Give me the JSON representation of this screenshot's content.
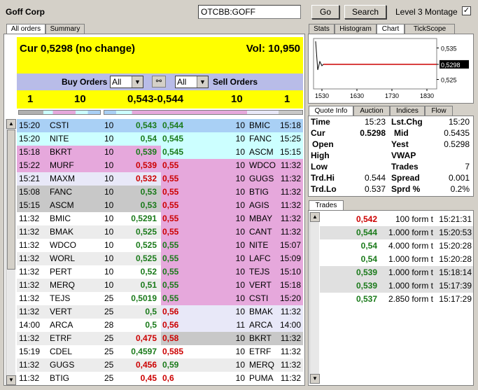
{
  "header": {
    "company": "Goff Corp",
    "symbol_value": "OTCBB:GOFF",
    "go_label": "Go",
    "search_label": "Search",
    "level3_label": "Level 3 Montage",
    "level3_checked": true
  },
  "left_tabs": [
    "All orders",
    "Summary"
  ],
  "summary": {
    "cur": "Cur 0,5298 (no change)",
    "vol": "Vol: 10,950",
    "buy_label": "Buy Orders",
    "buy_filter": "All",
    "sell_label": "Sell Orders",
    "sell_filter": "All",
    "bid_count": "1",
    "bid_size": "10",
    "spread": "0,543-0,544",
    "ask_size": "10",
    "ask_count": "1"
  },
  "bids": [
    {
      "time": "15:20",
      "mm": "CSTI",
      "size": "10",
      "price": "0,543",
      "color": "green",
      "bg": "#a9d0f5"
    },
    {
      "time": "15:20",
      "mm": "NITE",
      "size": "10",
      "price": "0,54",
      "color": "green",
      "bg": "#ccffff"
    },
    {
      "time": "15:18",
      "mm": "BKRT",
      "size": "10",
      "price": "0,539",
      "color": "green",
      "bg": "#e6a8dc"
    },
    {
      "time": "15:22",
      "mm": "MURF",
      "size": "10",
      "price": "0,539",
      "color": "red",
      "bg": "#e6a8dc"
    },
    {
      "time": "15:21",
      "mm": "MAXM",
      "size": "10",
      "price": "0,532",
      "color": "red",
      "bg": "#e8e8f8"
    },
    {
      "time": "15:08",
      "mm": "FANC",
      "size": "10",
      "price": "0,53",
      "color": "green",
      "bg": "#c8c8c8"
    },
    {
      "time": "15:15",
      "mm": "ASCM",
      "size": "10",
      "price": "0,53",
      "color": "green",
      "bg": "#c8c8c8"
    },
    {
      "time": "11:32",
      "mm": "BMIC",
      "size": "10",
      "price": "0,5291",
      "color": "green",
      "bg": "#ffffff"
    },
    {
      "time": "11:32",
      "mm": "BMAK",
      "size": "10",
      "price": "0,525",
      "color": "green",
      "bg": "#ececec"
    },
    {
      "time": "11:32",
      "mm": "WDCO",
      "size": "10",
      "price": "0,525",
      "color": "green",
      "bg": "#ffffff"
    },
    {
      "time": "11:32",
      "mm": "WORL",
      "size": "10",
      "price": "0,525",
      "color": "green",
      "bg": "#ececec"
    },
    {
      "time": "11:32",
      "mm": "PERT",
      "size": "10",
      "price": "0,52",
      "color": "green",
      "bg": "#ffffff"
    },
    {
      "time": "11:32",
      "mm": "MERQ",
      "size": "10",
      "price": "0,51",
      "color": "green",
      "bg": "#ececec"
    },
    {
      "time": "11:32",
      "mm": "TEJS",
      "size": "25",
      "price": "0,5019",
      "color": "green",
      "bg": "#ffffff"
    },
    {
      "time": "11:32",
      "mm": "VERT",
      "size": "25",
      "price": "0,5",
      "color": "green",
      "bg": "#ececec"
    },
    {
      "time": "14:00",
      "mm": "ARCA",
      "size": "28",
      "price": "0,5",
      "color": "green",
      "bg": "#ffffff"
    },
    {
      "time": "11:32",
      "mm": "ETRF",
      "size": "25",
      "price": "0,475",
      "color": "red",
      "bg": "#ececec"
    },
    {
      "time": "15:19",
      "mm": "CDEL",
      "size": "25",
      "price": "0,4597",
      "color": "green",
      "bg": "#ffffff"
    },
    {
      "time": "11:32",
      "mm": "GUGS",
      "size": "25",
      "price": "0,456",
      "color": "red",
      "bg": "#ececec"
    },
    {
      "time": "11:32",
      "mm": "BTIG",
      "size": "25",
      "price": "0,45",
      "color": "red",
      "bg": "#ffffff"
    }
  ],
  "asks": [
    {
      "price": "0,544",
      "color": "green",
      "size": "10",
      "mm": "BMIC",
      "time": "15:18",
      "bg": "#a9d0f5"
    },
    {
      "price": "0,545",
      "color": "green",
      "size": "10",
      "mm": "FANC",
      "time": "15:25",
      "bg": "#ccffff"
    },
    {
      "price": "0,545",
      "color": "green",
      "size": "10",
      "mm": "ASCM",
      "time": "15:15",
      "bg": "#ccffff"
    },
    {
      "price": "0,55",
      "color": "red",
      "size": "10",
      "mm": "WDCO",
      "time": "11:32",
      "bg": "#e6a8dc"
    },
    {
      "price": "0,55",
      "color": "red",
      "size": "10",
      "mm": "GUGS",
      "time": "11:32",
      "bg": "#e6a8dc"
    },
    {
      "price": "0,55",
      "color": "red",
      "size": "10",
      "mm": "BTIG",
      "time": "11:32",
      "bg": "#e6a8dc"
    },
    {
      "price": "0,55",
      "color": "red",
      "size": "10",
      "mm": "AGIS",
      "time": "11:32",
      "bg": "#e6a8dc"
    },
    {
      "price": "0,55",
      "color": "red",
      "size": "10",
      "mm": "MBAY",
      "time": "11:32",
      "bg": "#e6a8dc"
    },
    {
      "price": "0,55",
      "color": "red",
      "size": "10",
      "mm": "CANT",
      "time": "11:32",
      "bg": "#e6a8dc"
    },
    {
      "price": "0,55",
      "color": "green",
      "size": "10",
      "mm": "NITE",
      "time": "15:07",
      "bg": "#e6a8dc"
    },
    {
      "price": "0,55",
      "color": "green",
      "size": "10",
      "mm": "LAFC",
      "time": "15:09",
      "bg": "#e6a8dc"
    },
    {
      "price": "0,55",
      "color": "green",
      "size": "10",
      "mm": "TEJS",
      "time": "15:10",
      "bg": "#e6a8dc"
    },
    {
      "price": "0,55",
      "color": "green",
      "size": "10",
      "mm": "VERT",
      "time": "15:18",
      "bg": "#e6a8dc"
    },
    {
      "price": "0,55",
      "color": "green",
      "size": "10",
      "mm": "CSTI",
      "time": "15:20",
      "bg": "#e6a8dc"
    },
    {
      "price": "0,56",
      "color": "red",
      "size": "10",
      "mm": "BMAK",
      "time": "11:32",
      "bg": "#e8e8f8"
    },
    {
      "price": "0,56",
      "color": "red",
      "size": "11",
      "mm": "ARCA",
      "time": "14:00",
      "bg": "#e8e8f8"
    },
    {
      "price": "0,58",
      "color": "red",
      "size": "10",
      "mm": "BKRT",
      "time": "11:32",
      "bg": "#c8c8c8"
    },
    {
      "price": "0,585",
      "color": "red",
      "size": "10",
      "mm": "ETRF",
      "time": "11:32",
      "bg": "#ffffff"
    },
    {
      "price": "0,59",
      "color": "green",
      "size": "10",
      "mm": "MERQ",
      "time": "11:32",
      "bg": "#ececec"
    },
    {
      "price": "0,6",
      "color": "red",
      "size": "10",
      "mm": "PUMA",
      "time": "11:32",
      "bg": "#ffffff"
    }
  ],
  "chart_tabs": [
    "Stats",
    "Histogram",
    "Chart",
    "TickScope"
  ],
  "chart_data": {
    "type": "line",
    "x_ticks": [
      "1530",
      "1630",
      "1730",
      "1830"
    ],
    "y_ticks": [
      "0,535",
      "0,5298",
      "0,525"
    ],
    "current_label": "0,5298",
    "ylim": [
      0.522,
      0.538
    ],
    "series": [
      {
        "values": [
          0.5298,
          0.5298
        ]
      }
    ]
  },
  "quote_tabs": [
    "Quote Info",
    "Auction",
    "Indices",
    "Flow"
  ],
  "quote": {
    "time_l": "Time",
    "time_v": "15:23",
    "lst_l": "Lst.Chg",
    "lst_v": "15:20",
    "cur_l": "Cur",
    "cur_v": "0.5298",
    "mid_l": "Mid",
    "mid_v": "0.5435",
    "open_l": "Open",
    "open_v": "",
    "yest_l": "Yest",
    "yest_v": "0.5298",
    "high_l": "High",
    "high_v": "",
    "vwap_l": "VWAP",
    "vwap_v": "",
    "low_l": "Low",
    "low_v": "",
    "trades_l": "Trades",
    "trades_v": "7",
    "trdhi_l": "Trd.Hi",
    "trdhi_v": "0.544",
    "spread_l": "Spread",
    "spread_v": "0.001",
    "trdlo_l": "Trd.Lo",
    "trdlo_v": "0.537",
    "sprdp_l": "Sprd %",
    "sprdp_v": "0.2%"
  },
  "trades_tab": "Trades",
  "trades": [
    {
      "price": "0,542",
      "color": "red",
      "qty": "100 form t",
      "time": "15:21:31",
      "bg": "#ffffff"
    },
    {
      "price": "0,544",
      "color": "green",
      "qty": "1.000 form t",
      "time": "15:20:53",
      "bg": "#e0e0e0"
    },
    {
      "price": "0,54",
      "color": "green",
      "qty": "4.000 form t",
      "time": "15:20:28",
      "bg": "#ffffff"
    },
    {
      "price": "0,54",
      "color": "green",
      "qty": "1.000 form t",
      "time": "15:20:28",
      "bg": "#ffffff"
    },
    {
      "price": "0,539",
      "color": "green",
      "qty": "1.000 form t",
      "time": "15:18:14",
      "bg": "#e0e0e0"
    },
    {
      "price": "0,539",
      "color": "green",
      "qty": "1.000 form t",
      "time": "15:17:39",
      "bg": "#e0e0e0"
    },
    {
      "price": "0,537",
      "color": "green",
      "qty": "2.850 form t",
      "time": "15:17:29",
      "bg": "#ffffff"
    }
  ]
}
